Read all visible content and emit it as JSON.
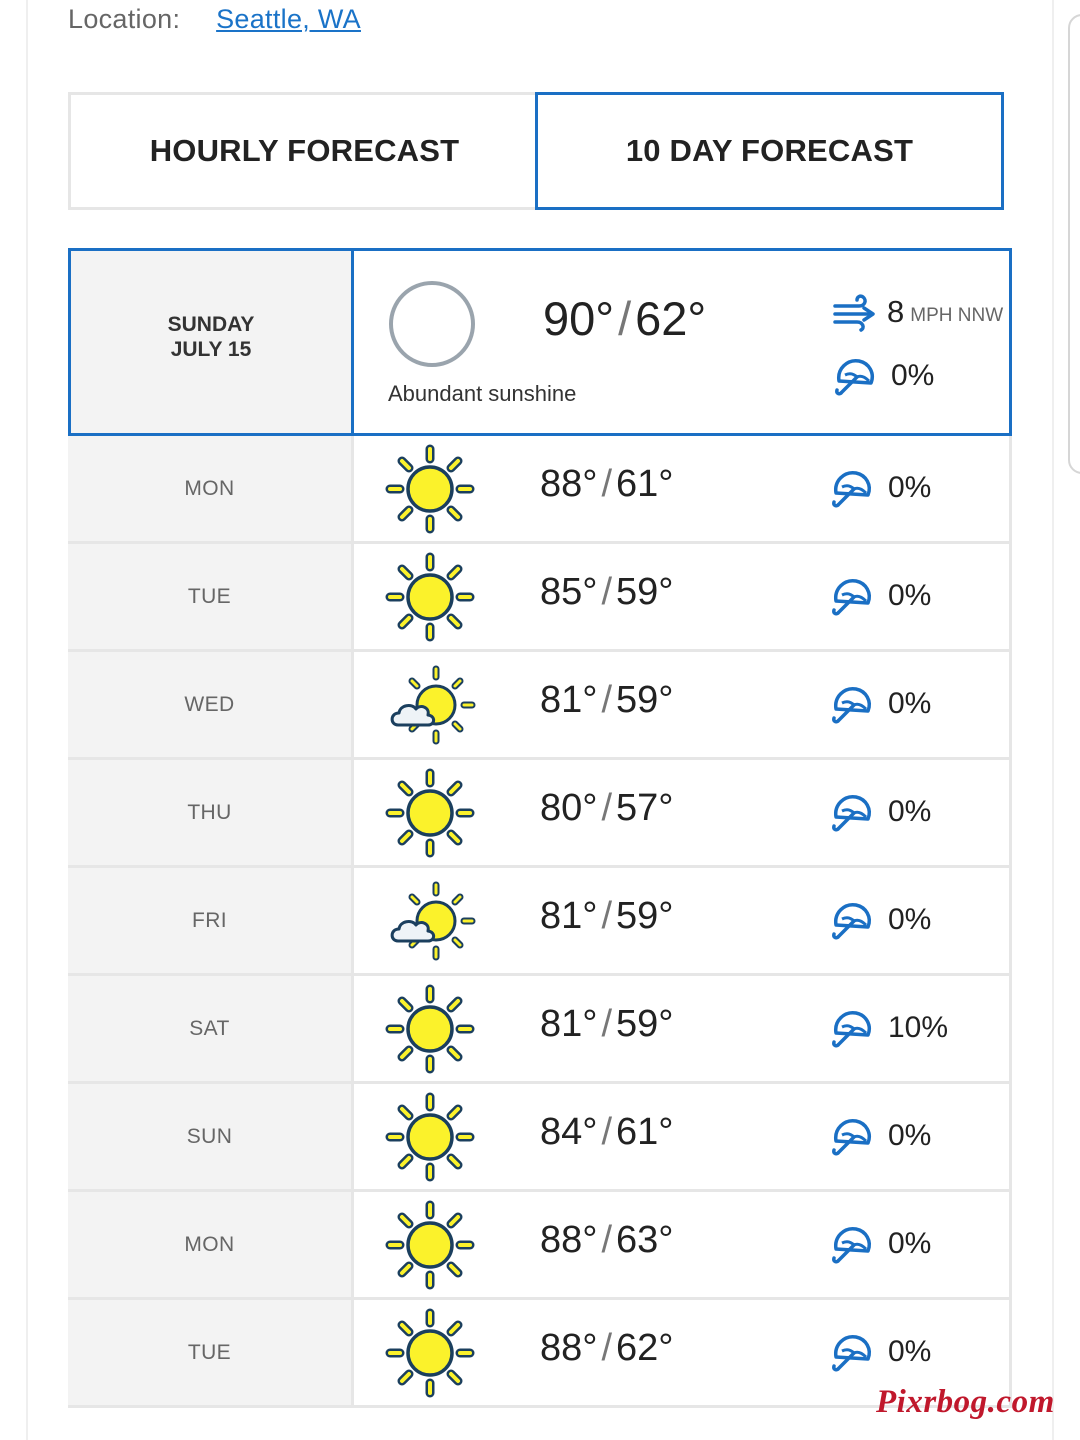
{
  "location": {
    "label": "Location:",
    "city": "Seattle, WA"
  },
  "tabs": {
    "hourly": "HOURLY FORECAST",
    "ten_day": "10 DAY FORECAST"
  },
  "today": {
    "day": "SUNDAY",
    "date": "JULY 15",
    "high": "90°",
    "low": "62°",
    "separator": "/",
    "summary": "Abundant sunshine",
    "icon": "clear-night-circle-icon",
    "wind_speed": "8",
    "wind_unit": "MPH NNW",
    "precip": "0%"
  },
  "days": [
    {
      "day": "MON",
      "high": "88°",
      "low": "61°",
      "icon": "sunny",
      "precip": "0%"
    },
    {
      "day": "TUE",
      "high": "85°",
      "low": "59°",
      "icon": "sunny",
      "precip": "0%"
    },
    {
      "day": "WED",
      "high": "81°",
      "low": "59°",
      "icon": "partly-sunny",
      "precip": "0%"
    },
    {
      "day": "THU",
      "high": "80°",
      "low": "57°",
      "icon": "sunny",
      "precip": "0%"
    },
    {
      "day": "FRI",
      "high": "81°",
      "low": "59°",
      "icon": "partly-sunny",
      "precip": "0%"
    },
    {
      "day": "SAT",
      "high": "81°",
      "low": "59°",
      "icon": "sunny",
      "precip": "10%"
    },
    {
      "day": "SUN",
      "high": "84°",
      "low": "61°",
      "icon": "sunny",
      "precip": "0%"
    },
    {
      "day": "MON",
      "high": "88°",
      "low": "63°",
      "icon": "sunny",
      "precip": "0%"
    },
    {
      "day": "TUE",
      "high": "88°",
      "low": "62°",
      "icon": "sunny",
      "precip": "0%"
    }
  ],
  "colors": {
    "accent": "#1a6fc4",
    "link": "#1a73c8",
    "sun": "#fbf22b",
    "outline": "#1b3f5e",
    "watermark": "#c0182c"
  },
  "watermark": "Pixrbog.com"
}
